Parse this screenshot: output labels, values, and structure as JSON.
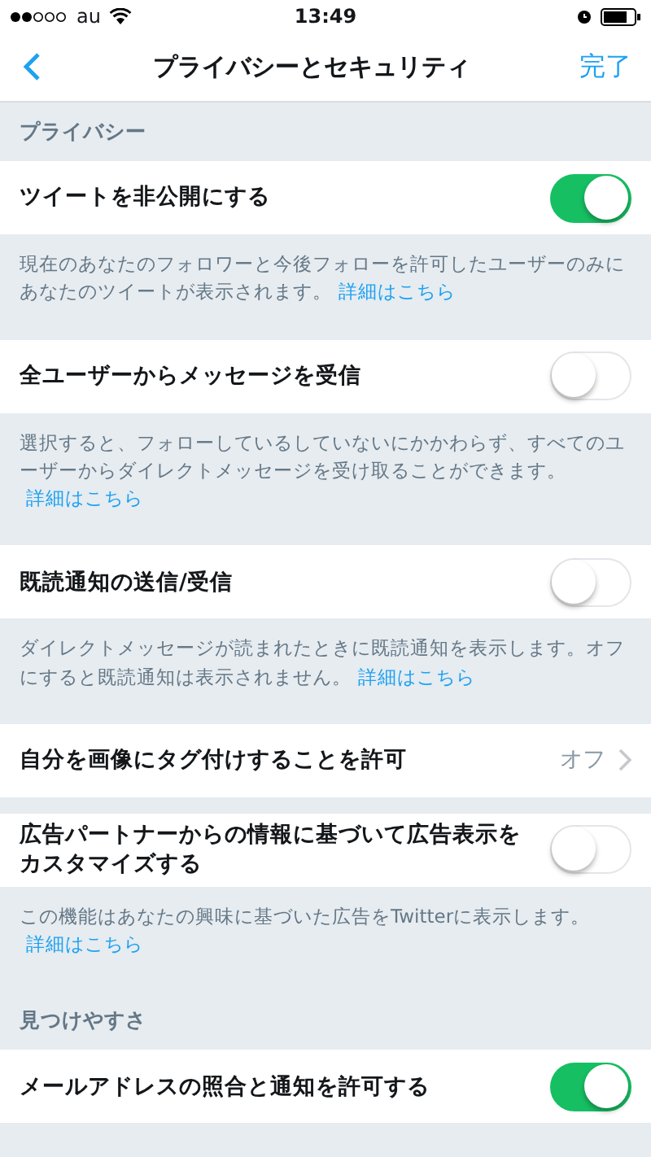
{
  "status_bar": {
    "carrier": "au",
    "time": "13:49"
  },
  "nav": {
    "title": "プライバシーとセキュリティ",
    "done": "完了"
  },
  "items": [
    {
      "kind": "header",
      "text": "プライバシー"
    },
    {
      "kind": "toggle",
      "label": "ツイートを非公開にする",
      "on": true
    },
    {
      "kind": "note",
      "text": "現在のあなたのフォロワーと今後フォローを許可したユーザーのみにあなたのツイートが表示されます。",
      "link": "詳細はこちら"
    },
    {
      "kind": "toggle",
      "label": "全ユーザーからメッセージを受信",
      "on": false
    },
    {
      "kind": "note",
      "text": "選択すると、フォローしているしていないにかかわらず、すべてのユーザーからダイレクトメッセージを受け取ることができます。",
      "link": "詳細はこちら"
    },
    {
      "kind": "toggle",
      "label": "既読通知の送信/受信",
      "on": false
    },
    {
      "kind": "note",
      "text": "ダイレクトメッセージが読まれたときに既読通知を表示します。オフにすると既読通知は表示されません。",
      "link": "詳細はこちら"
    },
    {
      "kind": "disclosure",
      "label": "自分を画像にタグ付けすることを許可",
      "value": "オフ"
    },
    {
      "kind": "spacer"
    },
    {
      "kind": "toggle",
      "label": "広告パートナーからの情報に基づいて広告表示をカスタマイズする",
      "on": false
    },
    {
      "kind": "note",
      "text": "この機能はあなたの興味に基づいた広告をTwitterに表示します。",
      "link": "詳細はこちら"
    },
    {
      "kind": "header",
      "text": "見つけやすさ"
    },
    {
      "kind": "toggle",
      "label": "メールアドレスの照合と通知を許可する",
      "on": true
    }
  ]
}
